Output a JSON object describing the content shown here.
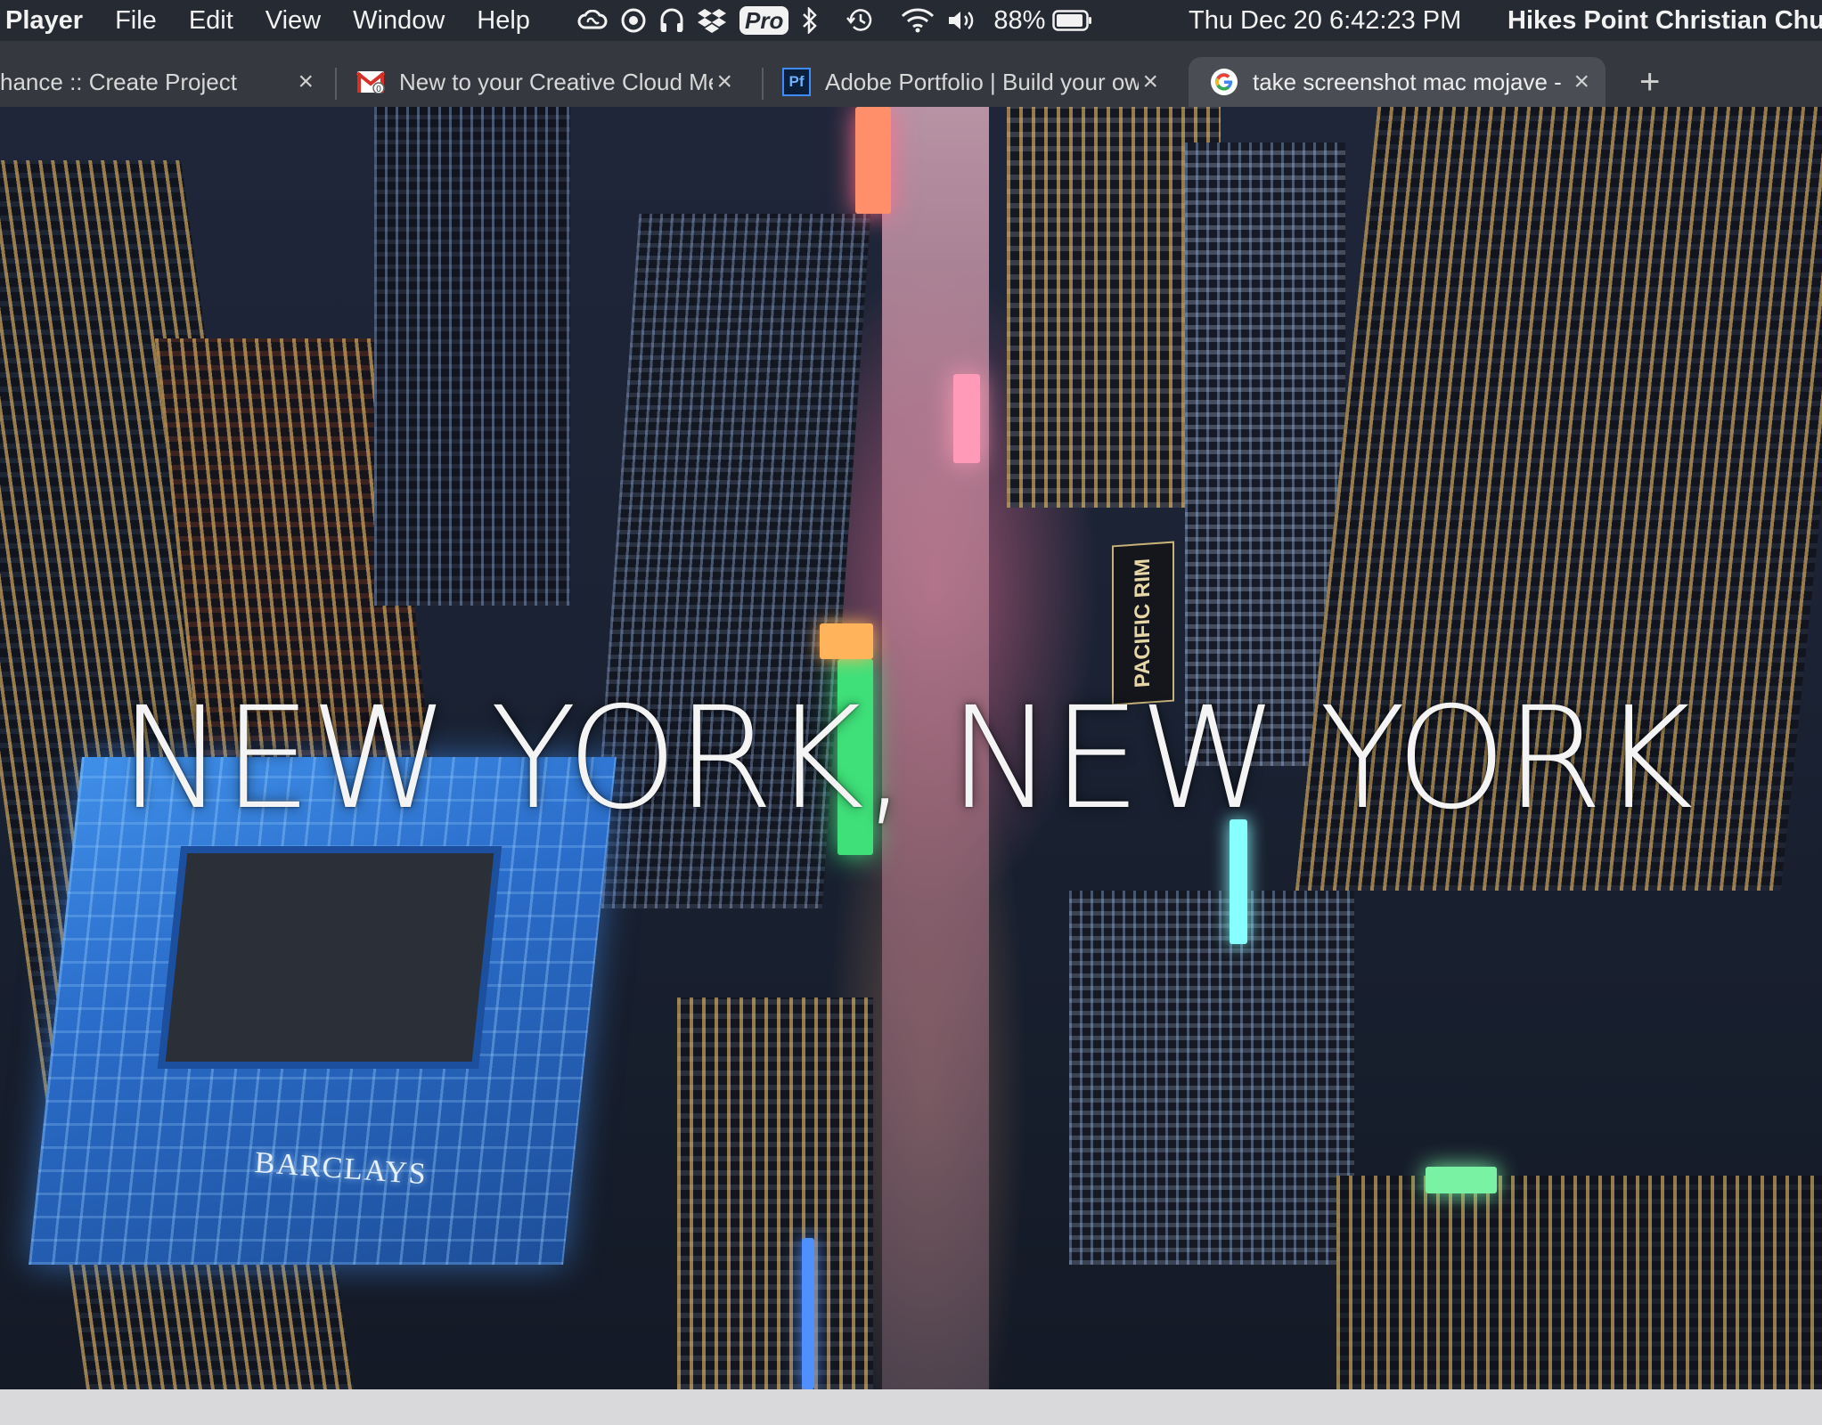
{
  "menubar": {
    "app_name": "Player",
    "items": [
      "File",
      "Edit",
      "View",
      "Window",
      "Help"
    ],
    "status_icons": [
      "creative-cloud-icon",
      "screen-recorder-icon",
      "headphones-icon",
      "dropbox-icon",
      "pro-badge",
      "bluetooth-icon",
      "time-machine-icon",
      "wifi-icon",
      "volume-icon",
      "battery-icon"
    ],
    "pro_label": "Pro",
    "battery_percent": "88%",
    "clock": "Thu Dec 20  6:42:23 PM",
    "user": "Hikes Point Christian Churc"
  },
  "tabs": [
    {
      "title": "hance :: Create Project",
      "favicon": "none",
      "active": false
    },
    {
      "title": "New to your Creative Cloud Me",
      "favicon": "gmail-icon",
      "active": false
    },
    {
      "title": "Adobe Portfolio | Build your ow",
      "favicon": "adobe-portfolio-icon",
      "favicon_text": "Pf",
      "active": false
    },
    {
      "title": "take screenshot mac mojave - ",
      "favicon": "google-icon",
      "active": true
    }
  ],
  "close_glyph": "×",
  "new_tab_glyph": "+",
  "video": {
    "title": "NEW YORK, NEW YORK",
    "billboard_text": "PACIFIC RIM",
    "building_sign": "BARCLAYS"
  },
  "colors": {
    "menubar_bg": "#262a33",
    "tabstrip_bg": "#35383e",
    "active_tab_bg": "#4a4d54",
    "barclays_blue": "#2a6cc9"
  }
}
